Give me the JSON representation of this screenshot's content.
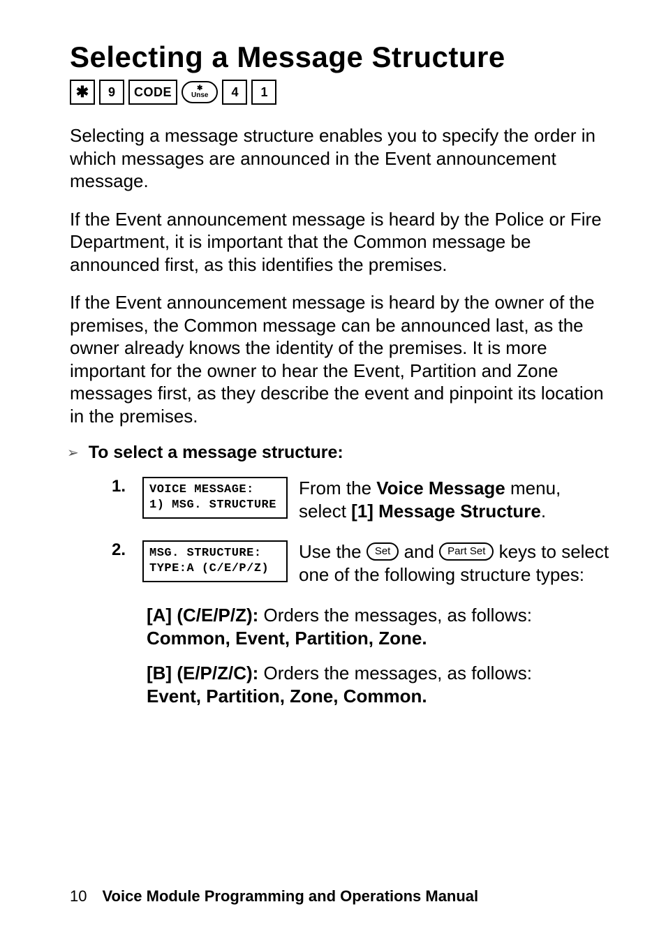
{
  "title": "Selecting a Message Structure",
  "keyseq": {
    "k1": "✱",
    "k2": "9",
    "k3": "CODE",
    "lozTop": "✱",
    "lozBot": "Unse",
    "k4": "4",
    "k5": "1"
  },
  "para1": "Selecting a message structure enables you to specify the order in which messages are announced in the Event announcement message.",
  "para2": "If the Event announcement message is heard by the Police or Fire Department, it is important that the Common message be announced first, as this identifies the premises.",
  "para3": "If the Event announcement message is heard by the owner of the premises, the Common message can be announced last, as the owner already knows the identity of the premises. It is more important for the owner to hear the Event, Partition and Zone messages first, as they describe the event and pinpoint its location in the premises.",
  "procHead": "To select a message structure:",
  "steps": [
    {
      "num": "1.",
      "lcd1": "VOICE MESSAGE:",
      "lcd2": "1) MSG. STRUCTURE",
      "desc_pre": "From the ",
      "desc_b1": "Voice Message",
      "desc_mid": " menu, select ",
      "desc_b2": "[1] Message Structure",
      "desc_post": "."
    },
    {
      "num": "2.",
      "lcd1": "MSG. STRUCTURE:",
      "lcd2": "TYPE:A (C/E/P/Z)",
      "desc_pre": "Use the ",
      "pill1": "Set",
      "desc_mid": " and ",
      "pill2": "Part Set",
      "desc_post": " keys to select one of the following structure types:"
    }
  ],
  "optA": {
    "head": "[A] (C/E/P/Z):",
    "txt": " Orders the messages, as follows:",
    "seq": "Common, Event, Partition, Zone."
  },
  "optB": {
    "head": "[B] (E/P/Z/C):",
    "txt": " Orders the messages, as follows:",
    "seq": "Event, Partition, Zone, Common."
  },
  "footer": {
    "page": "10",
    "title": "Voice Module Programming and Operations Manual"
  }
}
